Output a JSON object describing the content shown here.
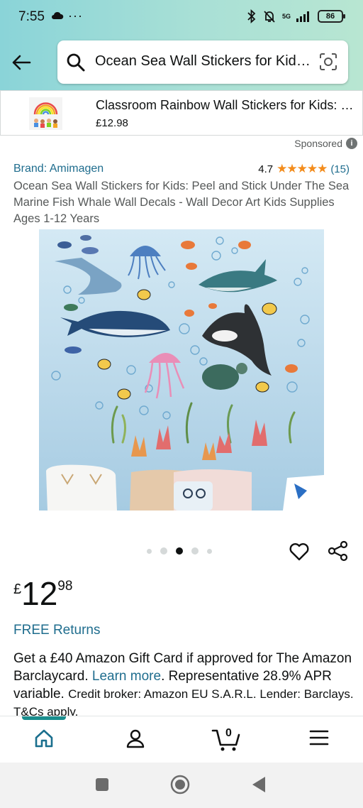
{
  "status_bar": {
    "time": "7:55",
    "overflow": "···",
    "signal_label": "5G",
    "battery": "86"
  },
  "search": {
    "query": "Ocean Sea Wall Stickers for Kids: Peel and Stick"
  },
  "sponsored_product": {
    "title": "Classroom Rainbow Wall Stickers for Kids: Peel and Stick",
    "price": "£12.98",
    "label": "Sponsored",
    "info_glyph": "i"
  },
  "product": {
    "brand": "Brand: Amimagen",
    "rating_value": "4.7",
    "stars": "★★★★★",
    "rating_count": "(15)",
    "title": "Ocean Sea Wall Stickers for Kids: Peel and Stick Under The Sea Marine Fish Whale Wall Decals - Wall Decor Art Kids Supplies Ages 1-12 Years",
    "image_index": 3,
    "image_count": 5
  },
  "price": {
    "currency": "£",
    "whole": "12",
    "fraction": "98"
  },
  "free_returns": "FREE Returns",
  "offer": {
    "line1": "Get a £40 Amazon Gift Card if approved for The Amazon Barclaycard.",
    "link": "Learn more",
    "dot": ".",
    "line2": "Representative 28.9% APR variable.",
    "small": "Credit broker: Amazon EU S.A.R.L. Lender: Barclays. T&Cs apply."
  },
  "bottom_nav": {
    "cart_count": "0",
    "active": "home"
  },
  "colors": {
    "link": "#1f6d8e",
    "stars": "#f38c1c",
    "header_gradient_start": "#8ad4d8",
    "header_gradient_end": "#b8e6d2",
    "active_nav": "#1a8e8e"
  }
}
